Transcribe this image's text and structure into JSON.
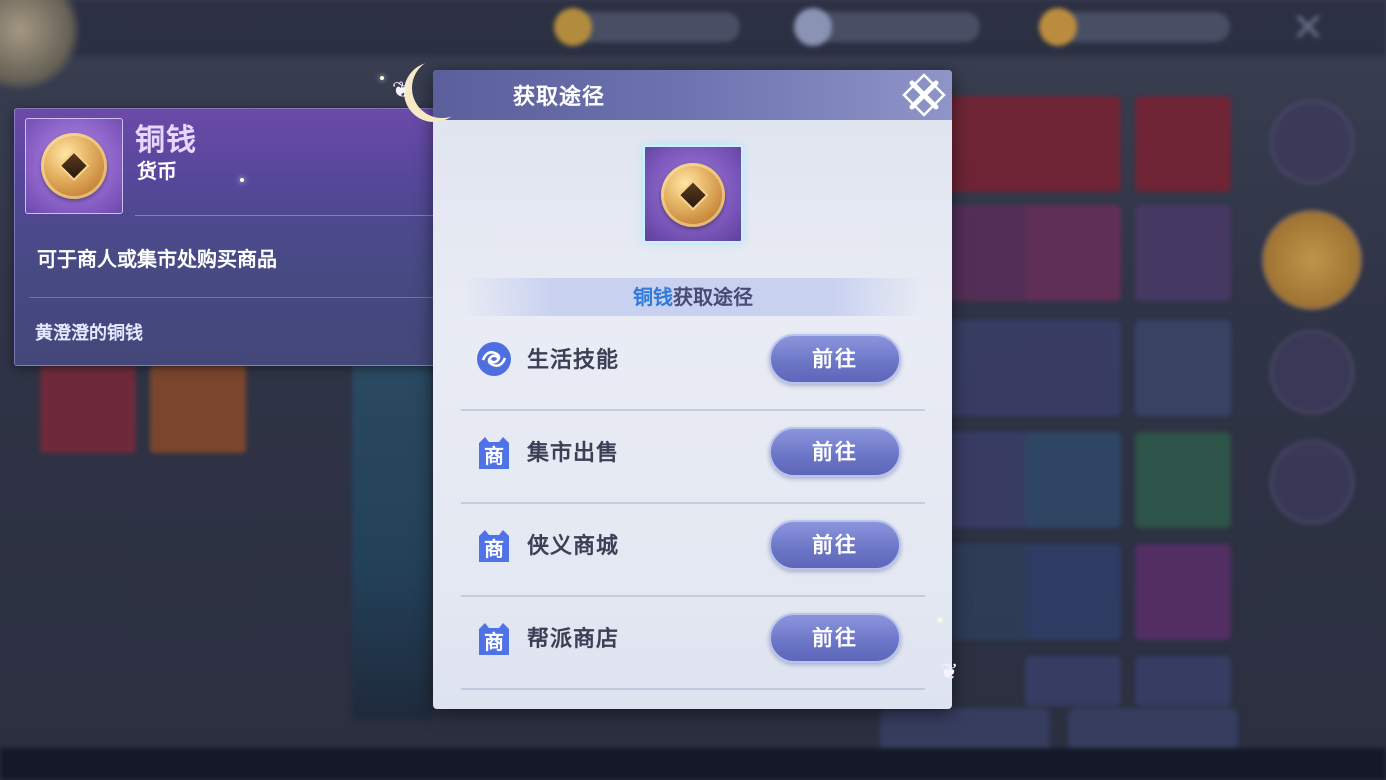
{
  "tooltip": {
    "name": "铜钱",
    "type": "货币",
    "description": "可于商人或集市处购买商品",
    "flavor": "黄澄澄的铜钱"
  },
  "panel": {
    "title": "获取途径",
    "band_item": "铜钱",
    "band_suffix": "获取途径",
    "routes": [
      {
        "label": "生活技能",
        "go": "前往",
        "icon": "skill-swirl-icon"
      },
      {
        "label": "集市出售",
        "go": "前往",
        "icon": "shop-icon"
      },
      {
        "label": "侠义商城",
        "go": "前往",
        "icon": "shop-icon"
      },
      {
        "label": "帮派商店",
        "go": "前往",
        "icon": "shop-icon"
      }
    ]
  },
  "colors": {
    "tooltip_bg": "#55479a",
    "panel_header": "#6d74b0",
    "button": "#6b75c6",
    "highlight": "#2f7bd9"
  }
}
